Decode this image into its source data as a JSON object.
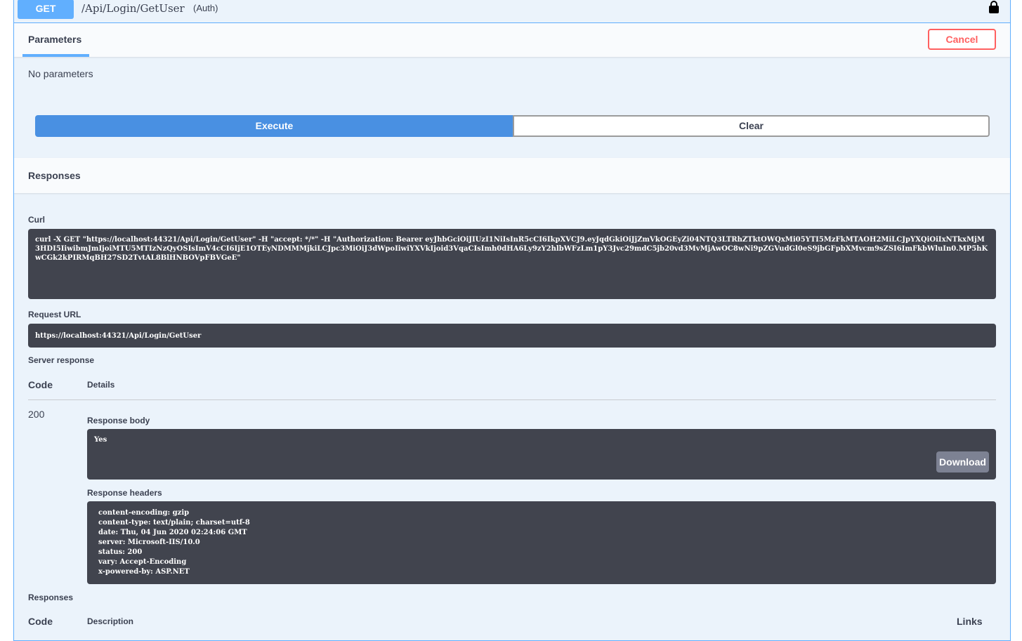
{
  "summary": {
    "method": "GET",
    "path": "/Api/Login/GetUser",
    "description": "(Auth)",
    "lock_icon": "lock-icon"
  },
  "parameters": {
    "tab_label": "Parameters",
    "cancel_label": "Cancel",
    "empty_text": "No parameters"
  },
  "actions": {
    "execute_label": "Execute",
    "clear_label": "Clear"
  },
  "responses_section": {
    "title": "Responses",
    "curl_label": "Curl",
    "curl_text": "curl -X GET \"https://localhost:44321/Api/Login/GetUser\" -H \"accept: */*\" -H \"Authorization: Bearer eyJhbGciOiJIUzI1NiIsInR5cCI6IkpXVCJ9.eyJqdGkiOiJjZmVkOGEyZi04NTQ3LTRhZTktOWQxMi05YTI5MzFkMTAOH2MiLCJpYXQiOiIxNTkxMjM3HDI5IiwibmJmIjoiMTU5MTIzNzQyOSIsImV4cCI6IjE1OTEyNDMMMjkiLCJpc3MiOiJ3dWpoIiwiYXVkIjoid3VqaCIsImh0dHA6Ly9zY2hlbWFzLm1pY3Jvc29mdC5jb20vd3MvMjAwOC8wNi9pZGVudGl0eS9jbGFpbXMvcm9sZSI6ImFkbWluIn0.MP5hKwCGk2kPIRMqBH27SD2TvtAL8BlHNBOVpFBVGeE\"",
    "request_url_label": "Request URL",
    "request_url": "https://localhost:44321/Api/Login/GetUser",
    "server_response_label": "Server response",
    "code_header": "Code",
    "details_header": "Details",
    "status_code": "200",
    "response_body_label": "Response body",
    "response_body": "Yes",
    "download_label": "Download",
    "response_headers_label": "Response headers",
    "response_headers": [
      "content-encoding: gzip",
      "content-type: text/plain; charset=utf-8",
      "date: Thu, 04 Jun 2020 02:24:06 GMT",
      "server: Microsoft-IIS/10.0",
      "status: 200",
      "vary: Accept-Encoding",
      "x-powered-by: ASP.NET"
    ]
  },
  "responses_table": {
    "title": "Responses",
    "code_header": "Code",
    "description_header": "Description",
    "links_header": "Links"
  }
}
